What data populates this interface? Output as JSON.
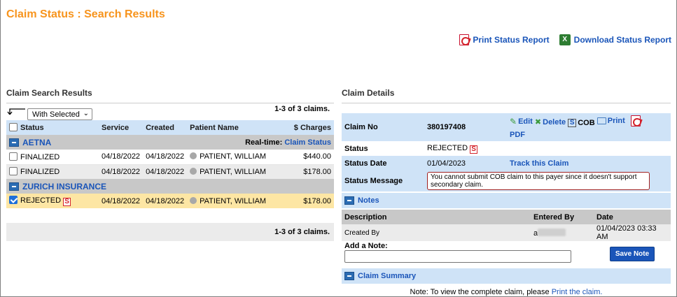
{
  "page": {
    "title": "Claim Status : Search Results",
    "print_report": "Print Status Report",
    "download_report": "Download Status Report"
  },
  "left": {
    "heading": "Claim Search Results",
    "with_selected": "With Selected",
    "count_top": "1-3 of 3 claims.",
    "count_bottom": "1-3 of 3 claims.",
    "columns": [
      "Status",
      "Service",
      "Created",
      "Patient Name",
      "$ Charges"
    ],
    "groups": [
      {
        "name": "AETNA",
        "realtime_label": "Real-time:",
        "realtime_link": "Claim Status",
        "rows": [
          {
            "status": "FINALIZED",
            "service": "04/18/2022",
            "created": "04/18/2022",
            "patient": "PATIENT, WILLIAM",
            "charges": "$440.00"
          },
          {
            "status": "FINALIZED",
            "service": "04/18/2022",
            "created": "04/18/2022",
            "patient": "PATIENT, WILLIAM",
            "charges": "$178.00"
          }
        ]
      },
      {
        "name": "ZURICH INSURANCE",
        "rows": [
          {
            "status": "REJECTED",
            "badge": "S",
            "service": "04/18/2022",
            "created": "04/18/2022",
            "patient": "PATIENT, WILLIAM",
            "charges": "$178.00",
            "selected": true
          }
        ]
      }
    ]
  },
  "right": {
    "heading": "Claim Details",
    "claim_no_label": "Claim No",
    "claim_no": "380197408",
    "actions": {
      "edit": "Edit",
      "delete": "Delete",
      "cob_badge": "S",
      "cob": "COB",
      "print": "Print",
      "pdf": "PDF"
    },
    "status_label": "Status",
    "status_value": "REJECTED",
    "status_badge": "S",
    "status_date_label": "Status Date",
    "status_date": "01/04/2023",
    "track_link": "Track this Claim",
    "status_message_label": "Status Message",
    "status_message": "You cannot submit COB claim to this payer since it doesn't support secondary claim.",
    "notes_label": "Notes",
    "notes_columns": [
      "Description",
      "Entered By",
      "Date"
    ],
    "note_row": {
      "description": "Created By",
      "entered_by": "a",
      "date": "01/04/2023 03:33 AM"
    },
    "add_note_label": "Add a Note:",
    "save_note": "Save Note",
    "claim_summary_label": "Claim Summary",
    "bottom_note_prefix": "Note:  To view the complete claim, please",
    "bottom_note_link": "Print the claim."
  }
}
